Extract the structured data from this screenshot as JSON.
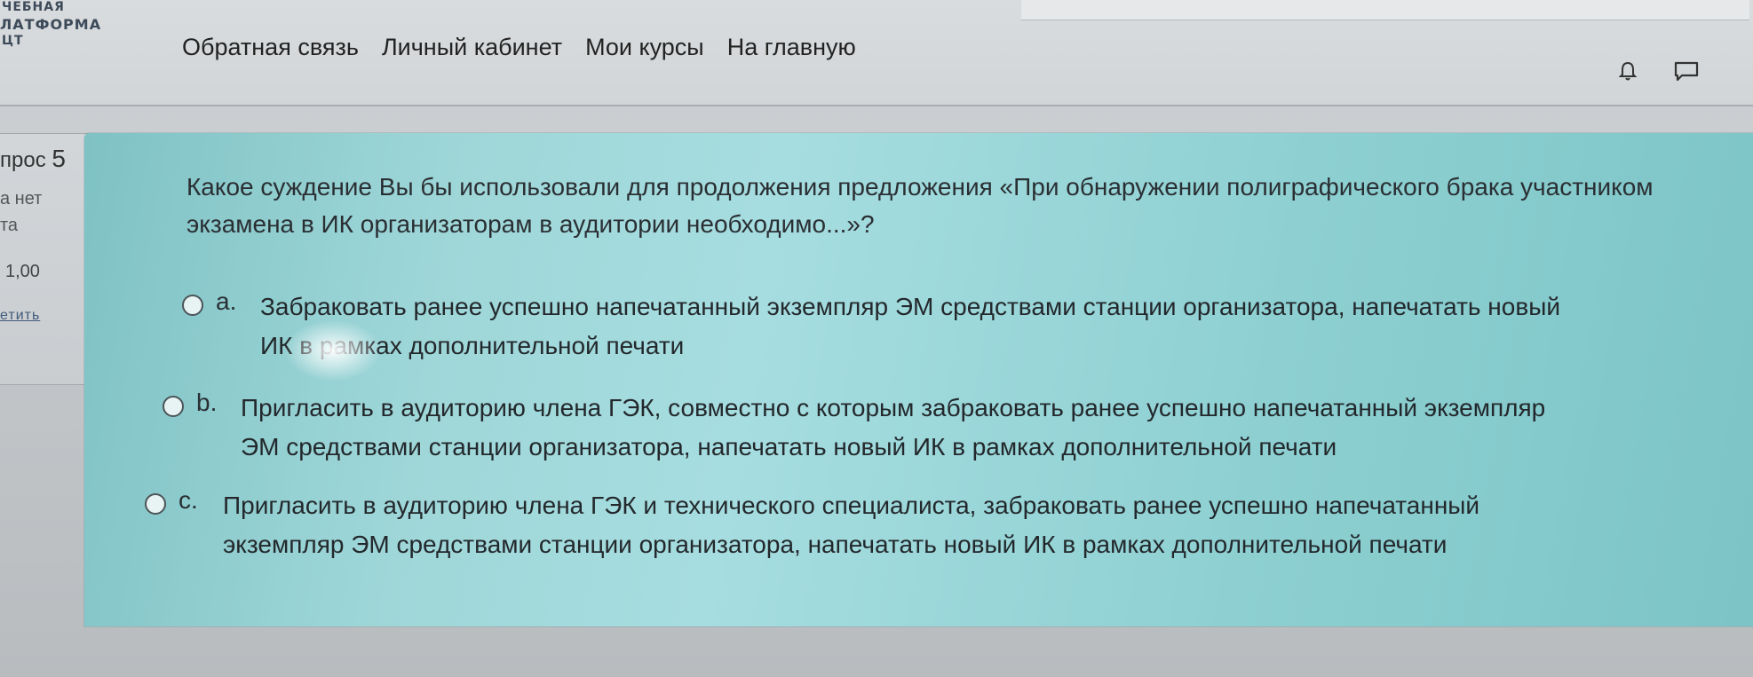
{
  "logo": {
    "line1": "ЧЕБНАЯ",
    "line2": "ЛАТФОРМА",
    "line3": "ЦТ"
  },
  "nav": [
    "Обратная связь",
    "Личный кабинет",
    "Мои курсы",
    "На главную"
  ],
  "icons": {
    "notifications": "bell-icon",
    "messages": "chat-icon"
  },
  "info": {
    "question_label": "прос",
    "question_number": "5",
    "status": "а нет",
    "mark_label": "та",
    "points": "1,00",
    "flag": "етить"
  },
  "question": {
    "text": "Какое суждение Вы бы использовали для продолжения предложения «При обнаружении полиграфического брака участником экзамена в ИК организаторам в аудитории необходимо...»?",
    "answers": [
      {
        "letter": "a.",
        "line1": "Забраковать ранее успешно напечатанный экземпляр ЭМ средствами станции организатора, напечатать новый",
        "line2": "ИК в рамках дополнительной печати"
      },
      {
        "letter": "b.",
        "line1": "Пригласить в аудиторию члена ГЭК, совместно с которым забраковать ранее успешно напечатанный экземпляр",
        "line2": "ЭМ средствами станции организатора, напечатать новый ИК в рамках дополнительной печати"
      },
      {
        "letter": "c.",
        "line1": "Пригласить в аудиторию члена ГЭК и технического специалиста, забраковать ранее успешно напечатанный",
        "line2": "экземпляр ЭМ средствами станции организатора, напечатать новый ИК в рамках дополнительной печати"
      }
    ]
  }
}
